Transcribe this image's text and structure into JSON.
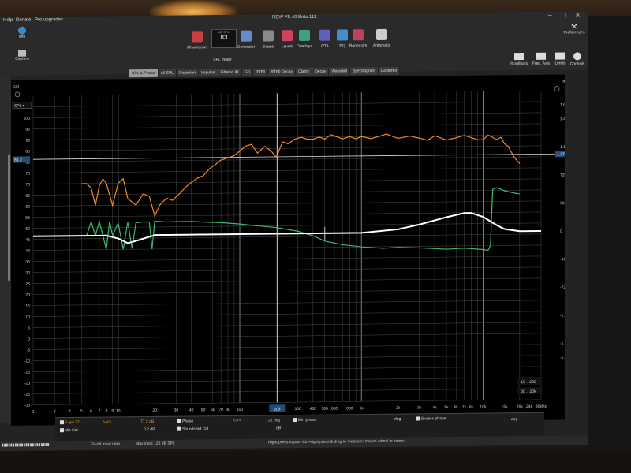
{
  "window": {
    "title": "REW V5.40 Beta 111",
    "menu": [
      "Help",
      "Donate",
      "Pro upgrades"
    ]
  },
  "toolbar": {
    "buttons": [
      {
        "label": "All windows",
        "icon": "windows-icon",
        "color": "#c94040"
      },
      {
        "label": "SPL meter",
        "icon": "spl-meter-icon",
        "color": "#222222"
      },
      {
        "label": "Generator",
        "icon": "generator-icon",
        "color": "#6a8ad0"
      },
      {
        "label": "Scope",
        "icon": "scope-icon",
        "color": "#8a8a8a"
      },
      {
        "label": "Levels",
        "icon": "levels-icon",
        "color": "#d04060"
      },
      {
        "label": "Overlays",
        "icon": "overlays-icon",
        "color": "#40a080"
      },
      {
        "label": "RTA",
        "icon": "rta-icon",
        "color": "#6060c0"
      },
      {
        "label": "EQ",
        "icon": "eq-icon",
        "color": "#4090d0"
      },
      {
        "label": "Room sim",
        "icon": "room-sim-icon",
        "color": "#c04060"
      },
      {
        "label": "Arithmetic",
        "icon": "arithmetic-icon",
        "color": "#cccccc"
      }
    ],
    "spl_meter": {
      "unit": "dB SPL",
      "value": "83"
    },
    "left": [
      {
        "label": "Info"
      },
      {
        "label": "Capture"
      }
    ],
    "right": [
      {
        "label": "Scrollbars"
      },
      {
        "label": "Freq. Axis"
      },
      {
        "label": "Limits"
      },
      {
        "label": "Controls"
      }
    ],
    "preferences": "Preferences"
  },
  "tabs": [
    {
      "label": "SPL & Phase",
      "active": true
    },
    {
      "label": "All SPL",
      "active": false
    },
    {
      "label": "Distortion",
      "active": false
    },
    {
      "label": "Impulse",
      "active": false
    },
    {
      "label": "Filtered IR",
      "active": false
    },
    {
      "label": "GD",
      "active": false
    },
    {
      "label": "RT60",
      "active": false
    },
    {
      "label": "RT60 Decay",
      "active": false
    },
    {
      "label": "Clarity",
      "active": false
    },
    {
      "label": "Decay",
      "active": false
    },
    {
      "label": "Waterfall",
      "active": false
    },
    {
      "label": "Spectrogram",
      "active": false
    },
    {
      "label": "Captured",
      "active": false
    }
  ],
  "plot": {
    "spl_select": "SPL",
    "y_unit_left": "SPL",
    "y_unit_right": "deg",
    "cursor_left_readout": "81.2",
    "cursor_right_readout": "1.37k",
    "cursor_freq_readout": "203",
    "range_boxes": [
      "10 .. 200",
      "20 .. 20k"
    ]
  },
  "chart_data": {
    "type": "line",
    "xscale": "log",
    "xlim": [
      2,
      30000
    ],
    "x_tick_labels": [
      "2",
      "3",
      "4",
      "5",
      "6",
      "7",
      "8",
      "9",
      "10",
      "20",
      "30",
      "40",
      "50",
      "60",
      "70",
      "80",
      "100",
      "200",
      "300",
      "400",
      "500",
      "600",
      "800",
      "1k",
      "2k",
      "3k",
      "4k",
      "5k",
      "6k",
      "7k",
      "8k",
      "10k",
      "15k",
      "20k",
      "24k",
      "30kHz"
    ],
    "y_left": {
      "label": "SPL",
      "lim": [
        -30,
        110
      ],
      "ticks": [
        105,
        100,
        95,
        90,
        85,
        80,
        75,
        70,
        65,
        60,
        55,
        50,
        45,
        40,
        35,
        30,
        25,
        20,
        15,
        10,
        5,
        0,
        -5,
        -10,
        -15,
        -20,
        -25,
        -30
      ]
    },
    "y_right": {
      "label": "deg",
      "lim": [
        -2160,
        1800
      ],
      "tick_labels": [
        "1.6k",
        "1.4k",
        "1.1k",
        "720",
        "360",
        "0",
        "-360",
        "-720",
        "-1.1k",
        "-1.4k",
        "-1.6k"
      ]
    },
    "series": [
      {
        "name": "SPL",
        "color": "#f08a24",
        "x": [
          5,
          5.5,
          6,
          6.5,
          7,
          7.5,
          8,
          9,
          10,
          11,
          12,
          14,
          16,
          18,
          20,
          22,
          25,
          28,
          32,
          36,
          40,
          45,
          50,
          56,
          63,
          70,
          80,
          90,
          100,
          110,
          125,
          140,
          160,
          180,
          200,
          225,
          250,
          280,
          320,
          360,
          400,
          450,
          500,
          560,
          630,
          700,
          800,
          900,
          1000,
          1200,
          1400,
          1600,
          2000,
          2500,
          3000,
          3500,
          4000,
          4500,
          5000,
          6000,
          7000,
          8000,
          9000,
          10000,
          11000,
          12000,
          13000,
          14000,
          15000,
          16000,
          18000,
          20000
        ],
        "y": [
          70,
          70,
          68,
          60,
          69,
          72,
          70,
          60,
          70,
          72,
          63,
          60,
          65,
          64,
          55,
          60,
          63,
          62,
          65,
          68,
          70,
          72,
          73,
          76,
          78,
          80,
          81,
          82,
          84,
          86,
          87,
          83,
          86,
          84,
          81,
          88,
          87,
          89,
          90,
          89,
          89,
          90,
          89,
          91,
          90,
          89,
          90,
          89,
          90,
          89,
          90,
          91,
          89,
          90,
          89,
          88,
          90,
          89,
          88,
          89,
          90,
          89,
          88,
          88,
          90,
          89,
          88,
          89,
          86,
          85,
          80,
          77
        ]
      },
      {
        "name": "Phase",
        "color": "#3cb870",
        "x": [
          5,
          5.5,
          6,
          6.5,
          7,
          7.5,
          8,
          8.5,
          9,
          10,
          11,
          12,
          13,
          14,
          16,
          18,
          19,
          20,
          25,
          30,
          40,
          50,
          70,
          100,
          150,
          200,
          300,
          400,
          500,
          700,
          1000,
          1500,
          2000,
          3000,
          5000,
          7000,
          10000,
          11000,
          11500,
          12000,
          13000,
          14000,
          15000,
          16000,
          18000,
          20000
        ],
        "y": [
          0,
          0,
          180,
          0,
          180,
          0,
          -180,
          180,
          0,
          160,
          -180,
          170,
          -170,
          160,
          170,
          170,
          -180,
          180,
          165,
          170,
          170,
          160,
          150,
          130,
          100,
          80,
          30,
          -30,
          -100,
          -150,
          -180,
          -200,
          -190,
          -200,
          -220,
          -210,
          -230,
          -240,
          -180,
          540,
          560,
          540,
          520,
          510,
          490,
          480
        ]
      },
      {
        "name": "Excess phase",
        "color": "#ffffff",
        "x": [
          2,
          5,
          8,
          10,
          12,
          15,
          20,
          30,
          50,
          100,
          200,
          300,
          500,
          1000,
          2000,
          3000,
          5000,
          7000,
          8000,
          10000,
          13000,
          15000,
          20000,
          30000
        ],
        "y": [
          0,
          0,
          0,
          -40,
          -100,
          -60,
          0,
          0,
          0,
          0,
          0,
          0,
          0,
          0,
          40,
          100,
          190,
          240,
          240,
          190,
          80,
          30,
          0,
          0
        ]
      }
    ]
  },
  "status": {
    "legend_name": "8 Apr 27",
    "mic_cal": "Mic Cal",
    "spl_value": "77.2 dB",
    "spl_sub": "0.2 dB",
    "phase": "Phase",
    "soundcard_cal": "Soundcard Cal",
    "phase_value": "21 deg",
    "phase_sub": "dB",
    "min_phase": "Min phase",
    "excess_phase": "Excess phase",
    "deg1": "deg",
    "deg2": "deg",
    "deg3": "deg"
  },
  "bottom": {
    "input": "24-bit input data",
    "max": "Max input 126 dB SPL",
    "hint": "Right press to pan; Ctrl+right press & drag to measure; mouse wheel to zoom;"
  },
  "colors": {
    "spl": "#f08a24",
    "phase": "#3cb870",
    "excess": "#ffffff",
    "grid": "#5a5a5a",
    "background": "#000000"
  }
}
